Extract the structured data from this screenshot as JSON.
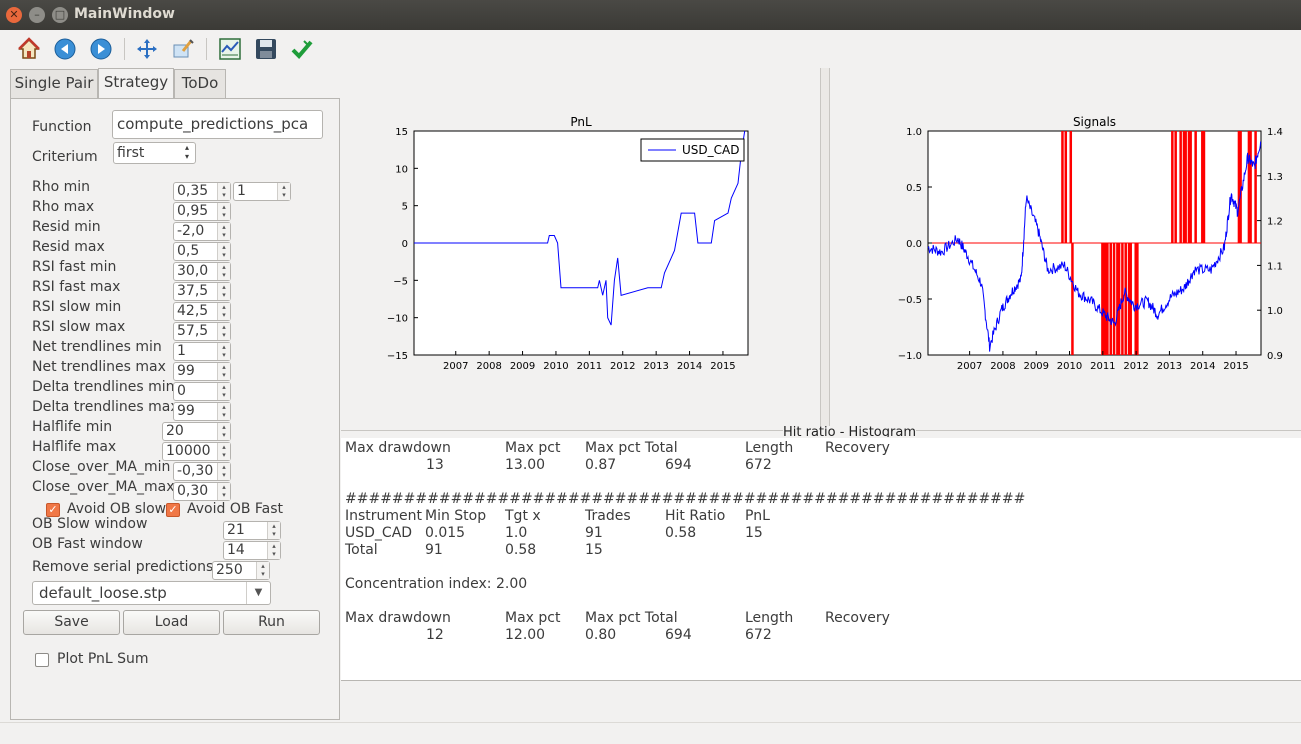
{
  "window": {
    "title": "MainWindow"
  },
  "toolbar": {
    "icons": [
      "home-icon",
      "back-icon",
      "forward-icon",
      "pan-icon",
      "zoom-icon",
      "subplots-icon",
      "save-icon",
      "check-icon"
    ]
  },
  "tabs": [
    {
      "label": "Single Pair"
    },
    {
      "label": "Strategy"
    },
    {
      "label": "ToDo"
    }
  ],
  "form": {
    "function_label": "Function",
    "function_value": "compute_predictions_pca",
    "criterium_label": "Criterium",
    "criterium_value": "first",
    "rows": [
      {
        "label": "Rho min",
        "value": "0,35"
      },
      {
        "label": "Rho max",
        "value": "0,95"
      },
      {
        "label": "Resid min",
        "value": "-2,0"
      },
      {
        "label": "Resid max",
        "value": "0,5"
      },
      {
        "label": "RSI fast min",
        "value": "30,0"
      },
      {
        "label": "RSI fast max",
        "value": "37,5"
      },
      {
        "label": "RSI slow min",
        "value": "42,5"
      },
      {
        "label": "RSI slow max",
        "value": "57,5"
      },
      {
        "label": "Net trendlines min",
        "value": "1"
      },
      {
        "label": "Net trendlines max",
        "value": "99"
      },
      {
        "label": "Delta trendlines min",
        "value": "0"
      },
      {
        "label": "Delta trendlines max",
        "value": "99"
      },
      {
        "label": "Halflife min",
        "value": "20"
      },
      {
        "label": "Halflife max",
        "value": "10000"
      },
      {
        "label": "Close_over_MA_min",
        "value": "-0,30"
      },
      {
        "label": "Close_over_MA_max",
        "value": "0,30"
      }
    ],
    "rho_extra": "1",
    "avoid_ob_slow": "Avoid OB slow",
    "avoid_ob_fast": "Avoid OB Fast",
    "ob_slow_label": "OB Slow window",
    "ob_slow_value": "21",
    "ob_fast_label": "OB Fast window",
    "ob_fast_value": "14",
    "remove_serial_label": "Remove serial predictions",
    "remove_serial_value": "250",
    "file_value": "default_loose.stp",
    "save_label": "Save",
    "load_label": "Load",
    "run_label": "Run",
    "plot_pnl_sum": "Plot PnL Sum"
  },
  "chart_data": [
    {
      "type": "line",
      "title": "PnL",
      "legend": [
        "USD_CAD"
      ],
      "legend_position": "top-right",
      "x_ticks": [
        "2007",
        "2008",
        "2009",
        "2010",
        "2011",
        "2012",
        "2013",
        "2014",
        "2015"
      ],
      "y_ticks": [
        "15",
        "10",
        "5",
        "0",
        "−5",
        "−10",
        "−15"
      ],
      "ylim": [
        -15,
        15
      ],
      "xlim": [
        2006.0,
        2016.0
      ],
      "series": [
        {
          "name": "USD_CAD",
          "color": "#0000ff",
          "points": [
            [
              2006.0,
              0
            ],
            [
              2010.0,
              0
            ],
            [
              2010.05,
              1
            ],
            [
              2010.2,
              1
            ],
            [
              2010.3,
              0
            ],
            [
              2010.4,
              -6
            ],
            [
              2011.5,
              -6
            ],
            [
              2011.55,
              -5
            ],
            [
              2011.65,
              -7
            ],
            [
              2011.75,
              -5
            ],
            [
              2011.8,
              -10
            ],
            [
              2011.9,
              -11
            ],
            [
              2012.0,
              -5
            ],
            [
              2012.1,
              -2
            ],
            [
              2012.2,
              -7
            ],
            [
              2013.0,
              -6
            ],
            [
              2013.4,
              -6
            ],
            [
              2013.5,
              -4
            ],
            [
              2013.7,
              -2
            ],
            [
              2013.8,
              -1
            ],
            [
              2014.0,
              4
            ],
            [
              2014.4,
              4
            ],
            [
              2014.5,
              0
            ],
            [
              2014.9,
              0
            ],
            [
              2015.0,
              3
            ],
            [
              2015.4,
              4
            ],
            [
              2015.5,
              6
            ],
            [
              2015.7,
              8
            ],
            [
              2015.8,
              12
            ],
            [
              2015.9,
              15
            ]
          ]
        }
      ]
    },
    {
      "type": "line",
      "title": "Signals",
      "x_ticks": [
        "2007",
        "2008",
        "2009",
        "2010",
        "2011",
        "2012",
        "2013",
        "2014",
        "2015"
      ],
      "y_ticks_left": [
        "1.0",
        "0.5",
        "0.0",
        "−0.5",
        "−1.0"
      ],
      "ylim_left": [
        -1.0,
        1.0
      ],
      "y_ticks_right": [
        "1.4",
        "1.3",
        "1.2",
        "1.1",
        "1.0",
        "0.9"
      ],
      "ylim_right": [
        0.9,
        1.4
      ],
      "xlim": [
        2006.0,
        2016.0
      ],
      "series": [
        {
          "name": "signals",
          "color": "#ff0000"
        },
        {
          "name": "price",
          "color": "#0000ff"
        }
      ]
    }
  ],
  "histogram_title": "Hit ratio - Histogram",
  "report": {
    "dd1": {
      "headers": [
        "Max drawdown",
        "Max pct",
        "Max pct Total",
        "Length",
        "Recovery"
      ],
      "values": [
        "13",
        "13.00",
        "0.87",
        "694",
        "672"
      ]
    },
    "hashes": "##########################################################",
    "table": {
      "headers": [
        "Instrument",
        "Min Stop",
        "Tgt x",
        "Trades",
        "Hit Ratio",
        "PnL"
      ],
      "rows": [
        [
          "USD_CAD",
          "0.015",
          "1.0",
          "91",
          "0.58",
          "15"
        ],
        [
          "Total",
          "91",
          "0.58",
          "15"
        ]
      ]
    },
    "concentration": "Concentration index: 2.00",
    "dd2": {
      "headers": [
        "Max drawdown",
        "Max pct",
        "Max pct Total",
        "Length",
        "Recovery"
      ],
      "values": [
        "12",
        "12.00",
        "0.80",
        "694",
        "672"
      ]
    }
  }
}
